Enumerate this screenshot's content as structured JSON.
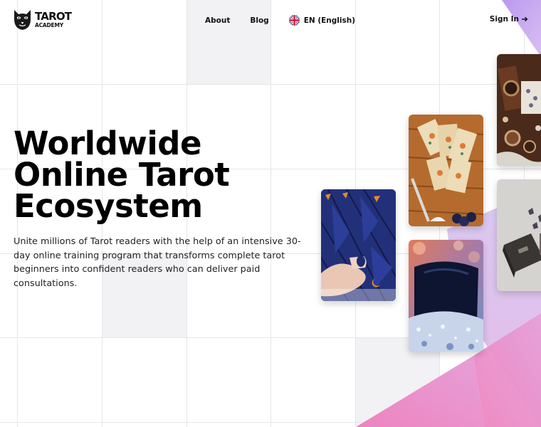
{
  "brand": {
    "name": "TAROT",
    "tagline": "ACADEMY",
    "logo_icon": "cat-skull-icon"
  },
  "nav": {
    "about": "About",
    "blog": "Blog",
    "language": "EN (English)",
    "language_icon": "uk-flag-icon"
  },
  "auth": {
    "sign_in": "Sign In",
    "sign_in_icon": "arrow-right-icon"
  },
  "hero": {
    "title_lines": [
      "Worldwide",
      "Online Tarot",
      "Ecosystem"
    ],
    "description": "Unite millions of Tarot readers with the help of an intensive 30-day online training program that transforms complete tarot beginners into confident readers who can deliver paid consultations."
  },
  "colors": {
    "accent_purple": "#c7a6ee",
    "accent_pink": "#e888c4",
    "grid_line": "#e6e6ea",
    "grid_fill": "#f2f2f5",
    "text": "#111111"
  }
}
